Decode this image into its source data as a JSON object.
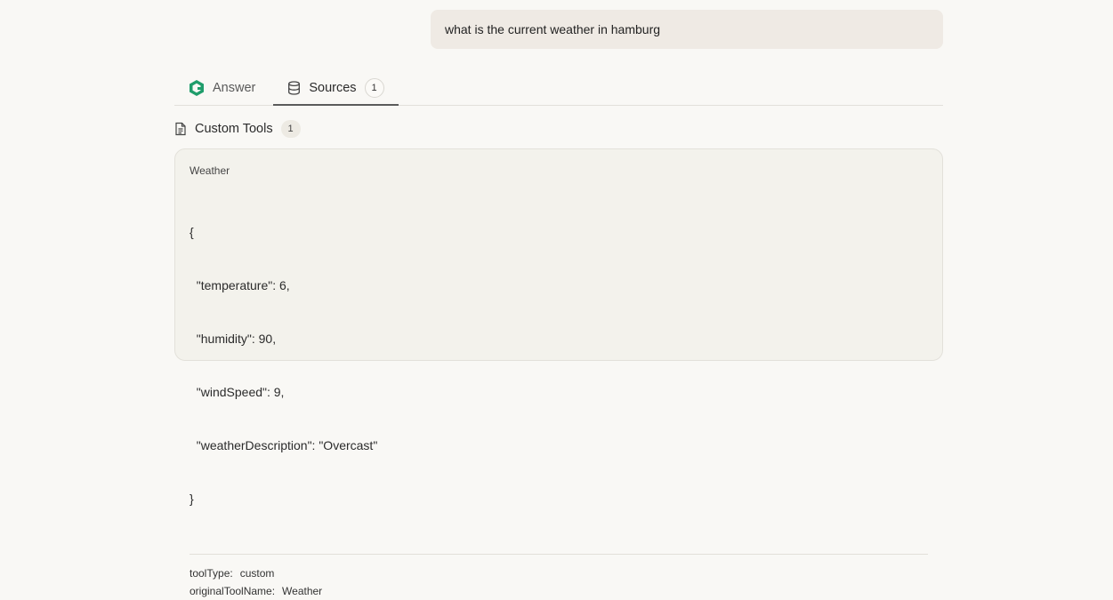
{
  "user_message": "what is the current weather in hamburg",
  "tabs": [
    {
      "label": "Answer",
      "icon": "answer-logo-icon",
      "active": false
    },
    {
      "label": "Sources",
      "icon": "database-icon",
      "active": true,
      "count": "1"
    }
  ],
  "section": {
    "label": "Custom Tools",
    "icon": "document-icon",
    "count": "1"
  },
  "source": {
    "title": "Weather",
    "json_lines": [
      "{",
      "  \"temperature\": 6,",
      "  \"humidity\": 90,",
      "  \"windSpeed\": 9,",
      "  \"weatherDescription\": \"Overcast\"",
      "}"
    ],
    "meta": [
      {
        "key": "toolType:",
        "value": "custom"
      },
      {
        "key": "originalToolName:",
        "value": "Weather"
      }
    ]
  },
  "colors": {
    "background": "#f9f8f5",
    "user_bubble": "#efeae4",
    "card": "#f3f2ec",
    "brand_green": "#1f9d6b"
  }
}
